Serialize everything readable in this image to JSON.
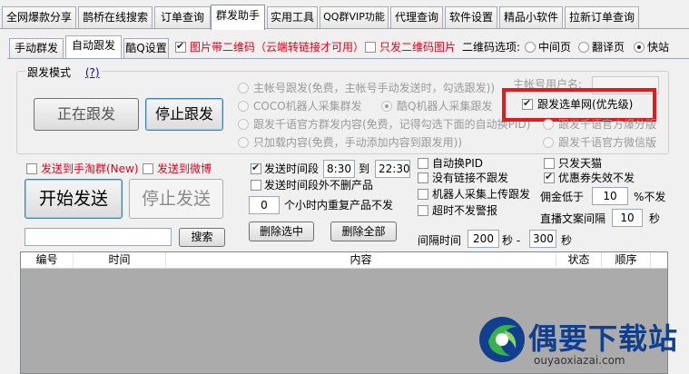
{
  "top_tabs": [
    "全网爆款分享",
    "鹊桥在线搜索",
    "订单查询",
    "群发助手",
    "实用工具",
    "QQ群VIP功能",
    "代理查询",
    "软件设置",
    "精品小软件",
    "拉新订单查询"
  ],
  "sub_tabs": [
    "手动群发",
    "自动跟发",
    "酷Q设置"
  ],
  "top_options": {
    "img_with_qr": "图片带二维码（云端转链接才可用）",
    "only_qr": "只发二维码图片",
    "qr_option_label": "二维码选项:",
    "qr_middle": "中间页",
    "qr_translate": "翻译页",
    "qr_fast": "快站"
  },
  "follow_mode": {
    "title": "跟发模式",
    "help": "(?)",
    "following_btn": "正在跟发",
    "stop_follow_btn": "停止跟发",
    "options": [
      "主帐号跟发(免费，主帐号手动发送时，勾选跟发))",
      "COCO机器人采集群发",
      "酷Q机器人采集跟发",
      "跟发千语官方群发内容(免费，记得勾选下面的自动换PID)",
      "只加载内容(免费，手动添加内容到跟发用))"
    ],
    "main_account_label": "主帐号用户名:",
    "select_single": "跟发选单网(优先级)",
    "qianyu_partial": "跟发千语官方爆分版",
    "qianyu_wechat": "跟发千语官方微信版"
  },
  "send": {
    "to_taobao": "发送到手淘群(New)",
    "to_weibo": "发送到微博",
    "start_btn": "开始发送",
    "stop_btn": "停止发送",
    "time_range_label": "发送时间段",
    "time_start": "8:30",
    "time_to": "到",
    "time_end": "22:30",
    "no_delete_outside": "发送时间段外不删产品",
    "repeat_hours": "0",
    "repeat_label": "个小时内重复产品不发",
    "delete_selected": "删除选中",
    "delete_all": "删除全部",
    "auto_pid": "自动换PID",
    "no_link_skip": "没有链接不跟发",
    "robot_upload": "机器人采集上传跟发",
    "timeout_alert": "超时不发警报",
    "only_tmall": "只发天猫",
    "coupon_invalid_skip": "优惠券失效不发",
    "commission_low_label": "佣金低于",
    "commission_low_value": "10",
    "commission_low_unit": "%不发",
    "broadcast_interval_label": "直播文案间隔",
    "broadcast_interval_value": "10",
    "broadcast_interval_unit": "秒",
    "interval_label": "间隔时间",
    "interval_min": "200",
    "interval_mid": "秒 -",
    "interval_max": "300",
    "interval_unit": "秒",
    "search_placeholder": "",
    "search_btn": "搜索"
  },
  "table": {
    "columns": [
      "编号",
      "时间",
      "内容",
      "状态",
      "顺序"
    ]
  },
  "watermark": {
    "name": "偶要下载站",
    "url": "ouyaoxiazai.com"
  }
}
